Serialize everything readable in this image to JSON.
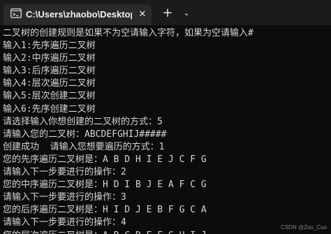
{
  "window": {
    "tab_title": "C:\\Users\\zhaobo\\Desktop\\de",
    "close_glyph": "✕",
    "new_tab_glyph": "+",
    "dropdown_glyph": "⌄",
    "icons": [
      "terminal-icon",
      "close-icon",
      "plus-icon",
      "chevron-down-icon"
    ]
  },
  "console": {
    "text_color": "#d6d6d6",
    "background": "#0c0c0c",
    "lines": [
      "二叉树的创建规则是如果不为空请输入字符，如果为空请输入#",
      "输入1:先序遍历二叉树",
      "输入2:中序遍历二叉树",
      "输入3:后序遍历二叉树",
      "输入4:层次遍历二叉树",
      "输入5:层次创建二叉树",
      "输入6:先序创建二叉树",
      "请选择输入你想创建的二叉树的方式：5",
      "请输入您的二叉树：ABCDEFGHIJ#####",
      "创建成功  请输入您想要遍历的方式：1",
      "您的先序遍历二叉树是：A B D H I E J C F G",
      "请输入下一步要进行的操作：2",
      "您的中序遍历二叉树是：H D I B J E A F C G",
      "请输入下一步要进行的操作：3",
      "您的后序遍历二叉树是：H I D J E B F G C A",
      "请输入下一步要进行的操作：4",
      "您的层次遍历二叉树是：A B C D E F G H I J"
    ]
  },
  "watermark": "CSDN @Zou_Cuo"
}
